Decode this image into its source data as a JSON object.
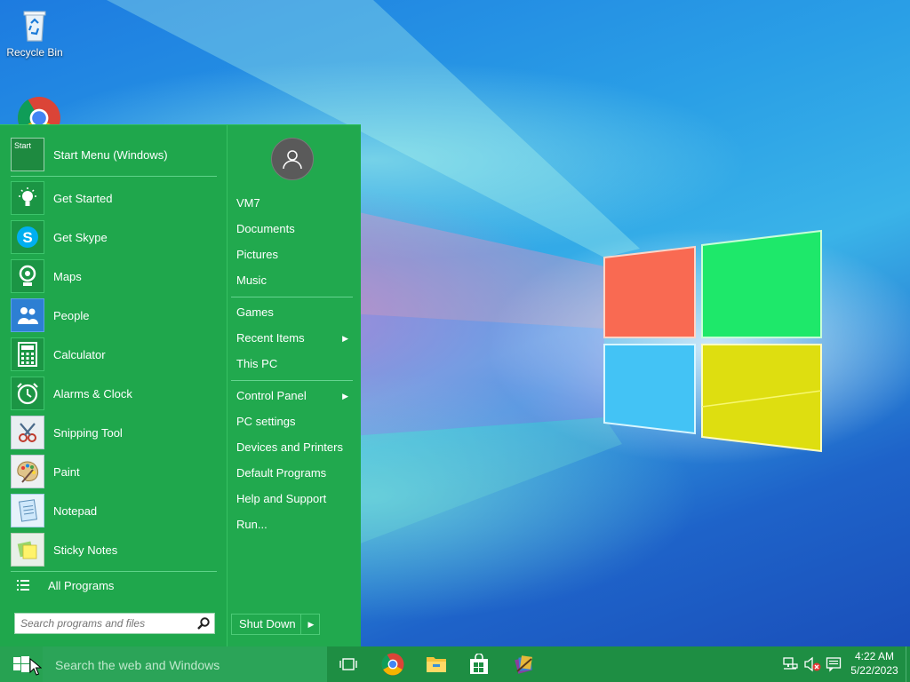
{
  "desktop": {
    "icons": [
      {
        "label": "Recycle Bin",
        "icon": "recycle-bin-icon"
      },
      {
        "label": "",
        "icon": "chrome-icon"
      }
    ]
  },
  "start_menu": {
    "programs": [
      {
        "label": "Start Menu (Windows)",
        "icon": "start-menu-app-icon"
      },
      {
        "label": "Get Started",
        "icon": "lightbulb-icon"
      },
      {
        "label": "Get Skype",
        "icon": "skype-icon"
      },
      {
        "label": "Maps",
        "icon": "maps-icon"
      },
      {
        "label": "People",
        "icon": "people-icon"
      },
      {
        "label": "Calculator",
        "icon": "calculator-icon"
      },
      {
        "label": "Alarms & Clock",
        "icon": "alarm-clock-icon"
      },
      {
        "label": "Snipping Tool",
        "icon": "snipping-tool-icon"
      },
      {
        "label": "Paint",
        "icon": "paint-palette-icon"
      },
      {
        "label": "Notepad",
        "icon": "notepad-icon"
      },
      {
        "label": "Sticky Notes",
        "icon": "sticky-notes-icon"
      }
    ],
    "start_icon_text": "Start",
    "all_programs": "All Programs",
    "search_placeholder": "Search programs and files",
    "right_links": [
      {
        "label": "VM7",
        "arrow": false
      },
      {
        "label": "Documents",
        "arrow": false
      },
      {
        "label": "Pictures",
        "arrow": false
      },
      {
        "label": "Music",
        "arrow": false
      },
      {
        "label": "Games",
        "arrow": false
      },
      {
        "label": "Recent Items",
        "arrow": true
      },
      {
        "label": "This PC",
        "arrow": false
      },
      {
        "label": "Control Panel",
        "arrow": true
      },
      {
        "label": "PC settings",
        "arrow": false
      },
      {
        "label": "Devices and Printers",
        "arrow": false
      },
      {
        "label": "Default Programs",
        "arrow": false
      },
      {
        "label": "Help and Support",
        "arrow": false
      },
      {
        "label": "Run...",
        "arrow": false
      }
    ],
    "shutdown_label": "Shut Down",
    "colors": {
      "menu_bg": "#1fa74c",
      "taskbar_bg": "#1e8e43"
    }
  },
  "taskbar": {
    "search_placeholder": "Search the web and Windows",
    "pinned": [
      "task-view-icon",
      "chrome-icon",
      "file-explorer-icon",
      "store-icon",
      "winrar-icon"
    ],
    "clock": {
      "time": "4:22 AM",
      "date": "5/22/2023"
    },
    "tray": [
      "network-icon",
      "speaker-muted-icon",
      "action-center-icon"
    ]
  }
}
